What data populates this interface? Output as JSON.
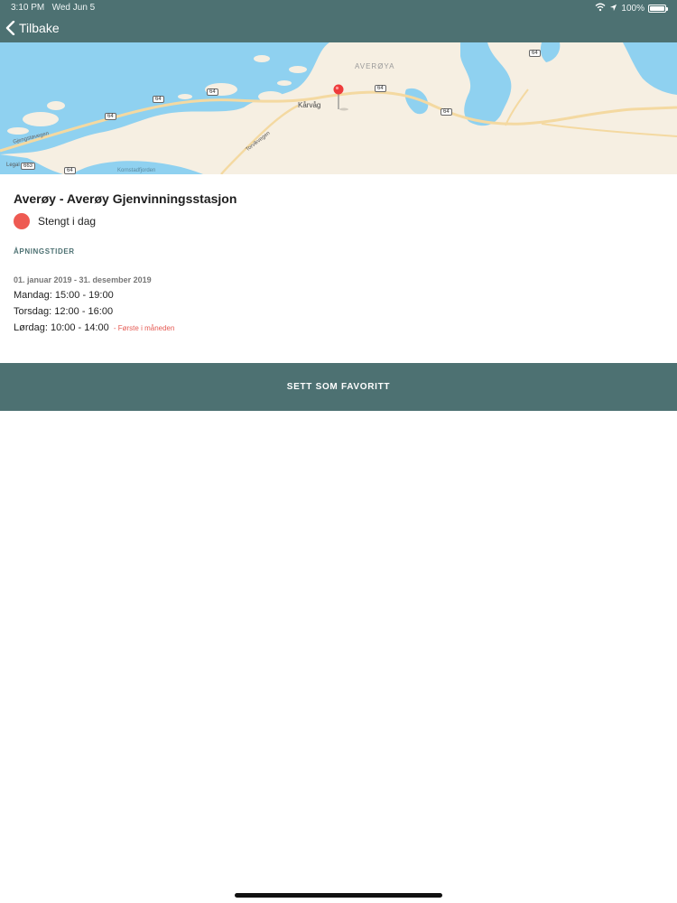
{
  "status_bar": {
    "time": "3:10 PM",
    "date": "Wed Jun 5",
    "battery": "100%"
  },
  "nav": {
    "back_label": "Tilbake"
  },
  "map": {
    "region_label": "AVERØYA",
    "town_label": "Kårvåg",
    "road_labels": [
      "64",
      "64",
      "64",
      "64",
      "64",
      "64",
      "663",
      "64"
    ],
    "street_label_1": "Gjengstøvegen",
    "street_label_2": "Torvikvegen",
    "street_label_3": "Kornstadfjorden",
    "attribution": "Legal"
  },
  "station": {
    "name": "Averøy - Averøy Gjenvinningsstasjon",
    "status_text": "Stengt i dag",
    "status_color": "#ee5a52"
  },
  "opening": {
    "section_title": "ÅPNINGSTIDER",
    "period": "01. januar 2019 - 31. desember 2019",
    "rows": [
      {
        "text": "Mandag: 15:00 - 19:00",
        "note": ""
      },
      {
        "text": "Torsdag: 12:00 - 16:00",
        "note": ""
      },
      {
        "text": "Lørdag: 10:00 - 14:00",
        "note": "- Første i måneden"
      }
    ]
  },
  "actions": {
    "favorite_label": "SETT SOM FAVORITT"
  },
  "colors": {
    "header": "#4d7172",
    "accent_red": "#ee5a52",
    "water": "#8fd1f0",
    "land": "#f6efe2"
  }
}
